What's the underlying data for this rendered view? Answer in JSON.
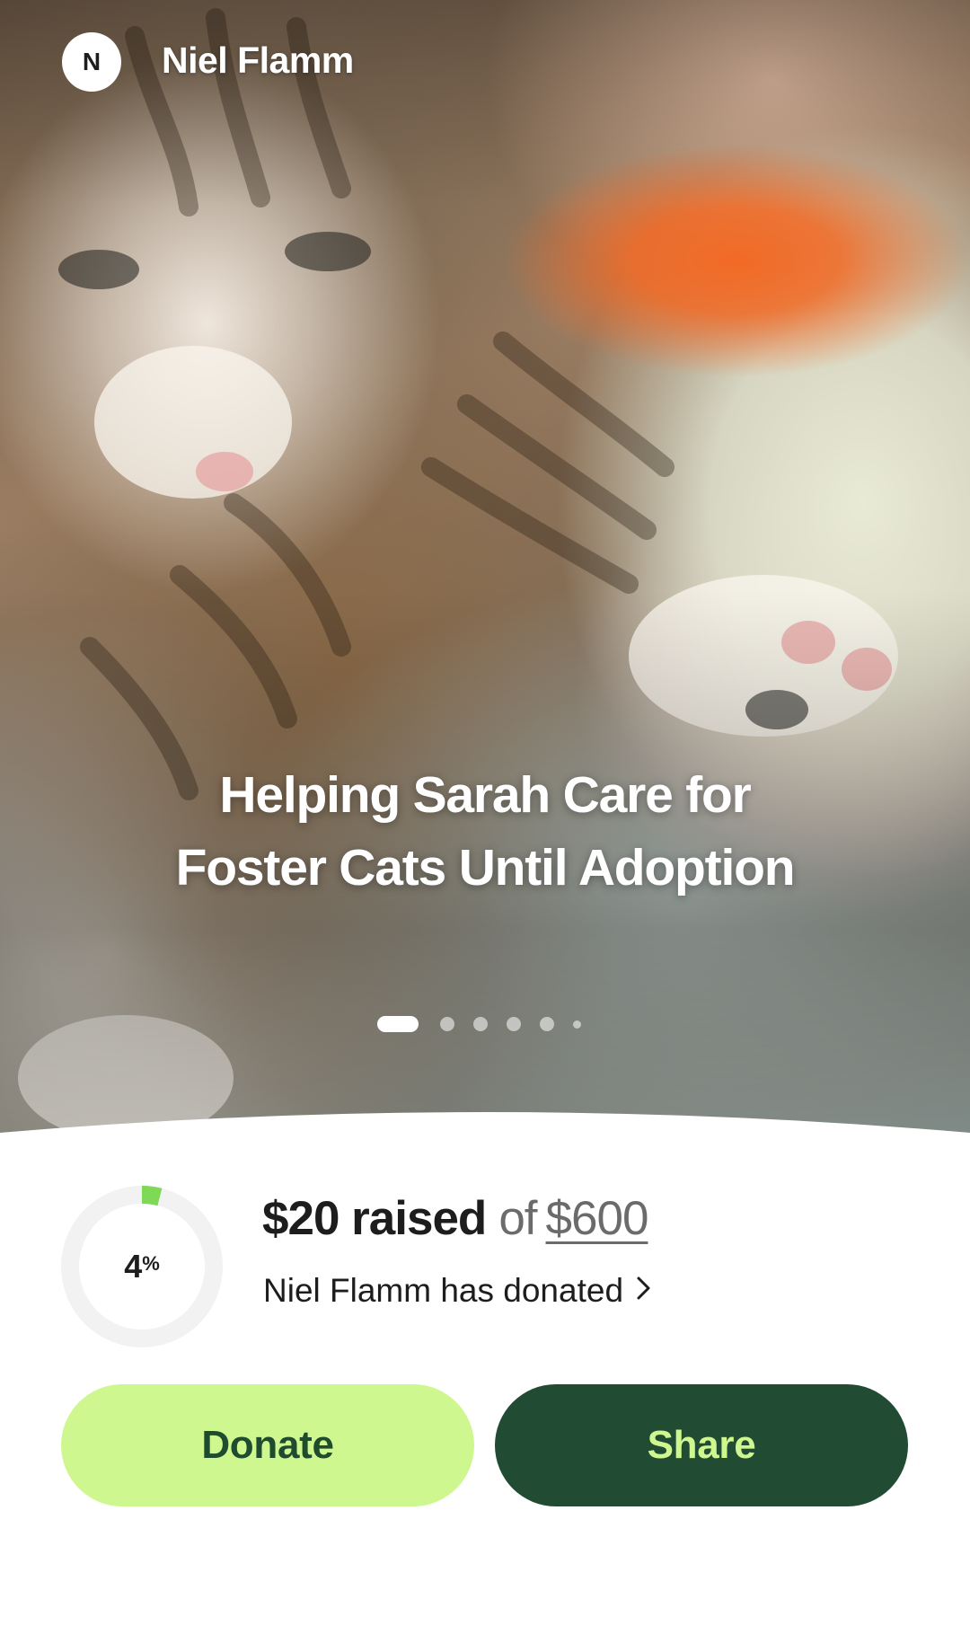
{
  "fundraiser": {
    "owner_initial": "N",
    "owner_name": "Niel Flamm",
    "title": "Helping Sarah Care for Foster Cats Until Adoption",
    "carousel": {
      "count": 6,
      "active_index": 0
    }
  },
  "progress": {
    "percent_label": "4",
    "percent_symbol": "%",
    "percent_value": 0.04,
    "raised": "$20 raised",
    "of": "of",
    "goal": "$600",
    "donor_note": "Niel Flamm has donated"
  },
  "actions": {
    "donate_label": "Donate",
    "share_label": "Share"
  },
  "colors": {
    "accent_light": "#cff78f",
    "accent_dark": "#224b33",
    "progress_fill": "#7ed957",
    "ring_track": "#f2f2f2"
  },
  "icons": {
    "donor_chevron": "chevron-right-icon"
  }
}
